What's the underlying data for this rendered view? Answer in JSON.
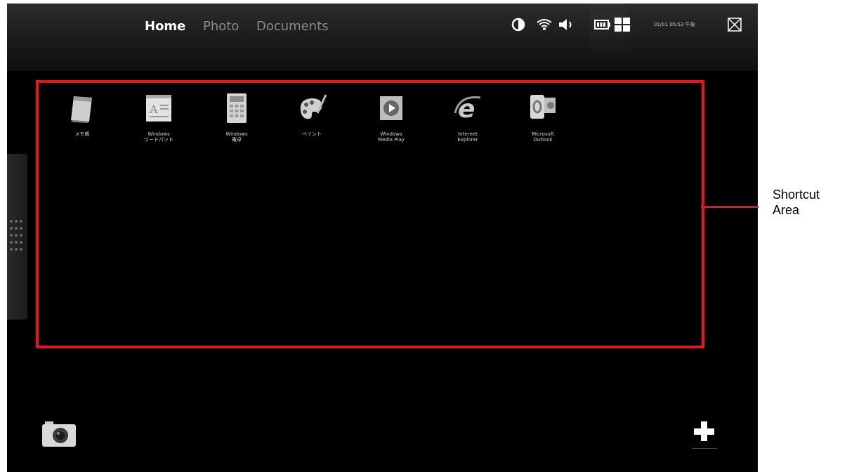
{
  "tabs": [
    {
      "label": "Home",
      "active": true
    },
    {
      "label": "Photo",
      "active": false
    },
    {
      "label": "Documents",
      "active": false
    }
  ],
  "status": {
    "icons": [
      "brightness-icon",
      "wifi-icon",
      "volume-icon",
      "battery-icon",
      "grid-view-icon",
      "close-icon"
    ],
    "clock": "01/01 05:53 午後"
  },
  "shortcuts": [
    {
      "label": "メモ帳",
      "icon": "notepad-icon"
    },
    {
      "label": "Windows\nワードパッド",
      "icon": "wordpad-icon"
    },
    {
      "label": "Windows\n電卓",
      "icon": "calculator-icon"
    },
    {
      "label": "ペイント",
      "icon": "paint-icon"
    },
    {
      "label": "Windows\nMedia Play",
      "icon": "media-player-icon"
    },
    {
      "label": "Internet\nExplorer",
      "icon": "internet-explorer-icon"
    },
    {
      "label": "Microsoft\nOutlook",
      "icon": "outlook-icon"
    }
  ],
  "annotation": {
    "label_line1": "Shortcut",
    "label_line2": "Area",
    "color": "#e8141b"
  },
  "bottom": {
    "camera_icon": "camera-icon",
    "add_icon": "plus-icon"
  }
}
